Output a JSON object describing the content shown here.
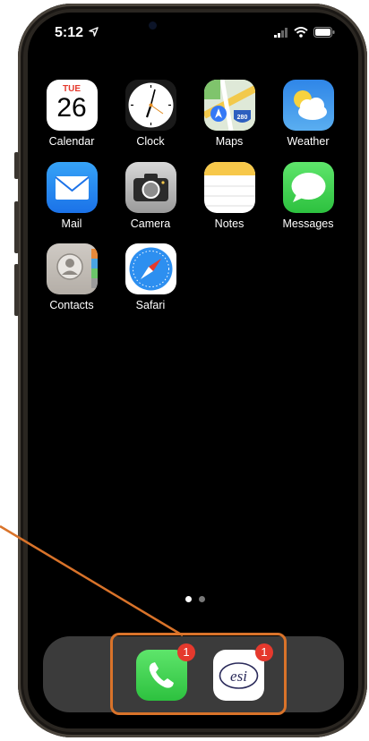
{
  "status_bar": {
    "time": "5:12"
  },
  "apps": [
    {
      "label": "Calendar",
      "icon": "calendar-icon",
      "day": "TUE",
      "date": "26"
    },
    {
      "label": "Clock",
      "icon": "clock-icon"
    },
    {
      "label": "Maps",
      "icon": "maps-icon",
      "shield": "280"
    },
    {
      "label": "Weather",
      "icon": "weather-icon"
    },
    {
      "label": "Mail",
      "icon": "mail-icon"
    },
    {
      "label": "Camera",
      "icon": "camera-icon"
    },
    {
      "label": "Notes",
      "icon": "notes-icon"
    },
    {
      "label": "Messages",
      "icon": "messages-icon"
    },
    {
      "label": "Contacts",
      "icon": "contacts-icon"
    },
    {
      "label": "Safari",
      "icon": "safari-icon"
    }
  ],
  "dock": {
    "apps": [
      {
        "name": "Phone",
        "icon": "phone-icon",
        "badge": "1"
      },
      {
        "name": "ESI",
        "icon": "esi-icon",
        "logo_text": "esi",
        "badge": "1"
      }
    ]
  },
  "page_indicator": {
    "pages": 2,
    "current": 1
  },
  "colors": {
    "annotation": "#d9732a",
    "badge": "#e5392d"
  }
}
